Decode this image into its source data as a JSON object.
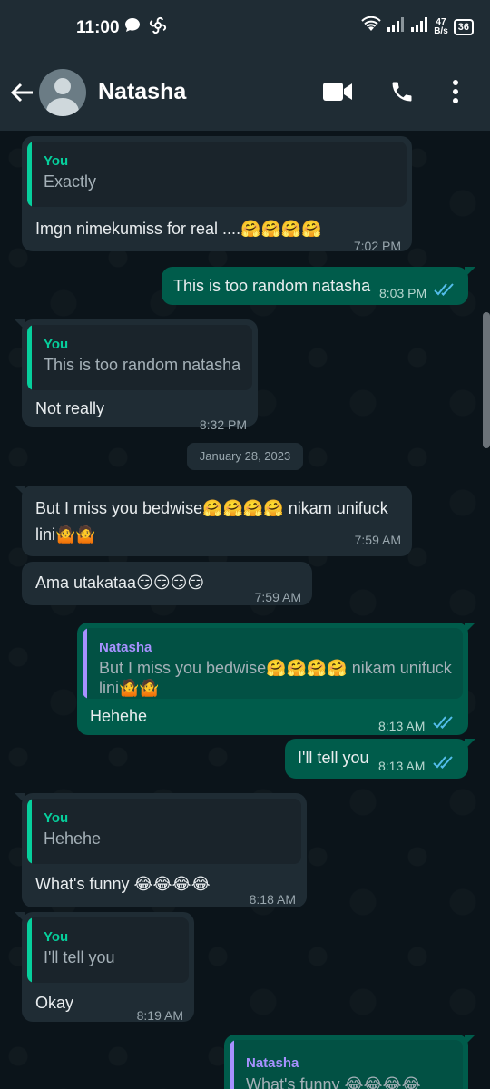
{
  "status_bar": {
    "time": "11:00",
    "net_speed_value": "47",
    "net_speed_unit": "B/s",
    "battery": "36"
  },
  "header": {
    "contact_name": "Natasha"
  },
  "colors": {
    "header_bg": "#1f2c34",
    "chat_bg": "#0b141a",
    "incoming_bubble": "#1f2c34",
    "outgoing_bubble": "#005c4b",
    "quote_you_accent": "#06cf9c",
    "quote_natasha_accent": "#a791ff",
    "read_ticks": "#53bdeb"
  },
  "messages": [
    {
      "direction": "in",
      "quote_author": "You",
      "quote_text": "Exactly",
      "text": "Imgn nimekumiss for real ....🤗🤗🤗🤗",
      "time": "7:02 PM"
    },
    {
      "direction": "out",
      "text": "This is too random natasha",
      "time": "8:03 PM",
      "status": "read"
    },
    {
      "direction": "in",
      "quote_author": "You",
      "quote_text": "This is too random natasha",
      "text": "Not really",
      "time": "8:32 PM"
    },
    {
      "direction": "in",
      "text_line1": "But I miss you bedwise🤗🤗🤗🤗 nikam unifuck",
      "text_line2": "lini🤷🤷",
      "time": "7:59 AM"
    },
    {
      "direction": "in",
      "text": "Ama utakataa😏😏😏😏",
      "time": "7:59 AM"
    },
    {
      "direction": "out",
      "quote_author": "Natasha",
      "quote_line1": "But I miss you bedwise🤗🤗🤗🤗 nikam unifuck",
      "quote_line2": "lini🤷🤷",
      "text": "Hehehe",
      "time": "8:13 AM",
      "status": "read"
    },
    {
      "direction": "out",
      "text": "I'll tell you",
      "time": "8:13 AM",
      "status": "read"
    },
    {
      "direction": "in",
      "quote_author": "You",
      "quote_text": "Hehehe",
      "text": "What's funny 😂😂😂😂",
      "time": "8:18 AM"
    },
    {
      "direction": "in",
      "quote_author": "You",
      "quote_text": "I'll tell you",
      "text": "Okay",
      "time": "8:19 AM"
    },
    {
      "direction": "out",
      "quote_author": "Natasha",
      "quote_text": "What's funny 😂😂😂😂"
    }
  ],
  "date_separator": "January 28, 2023"
}
